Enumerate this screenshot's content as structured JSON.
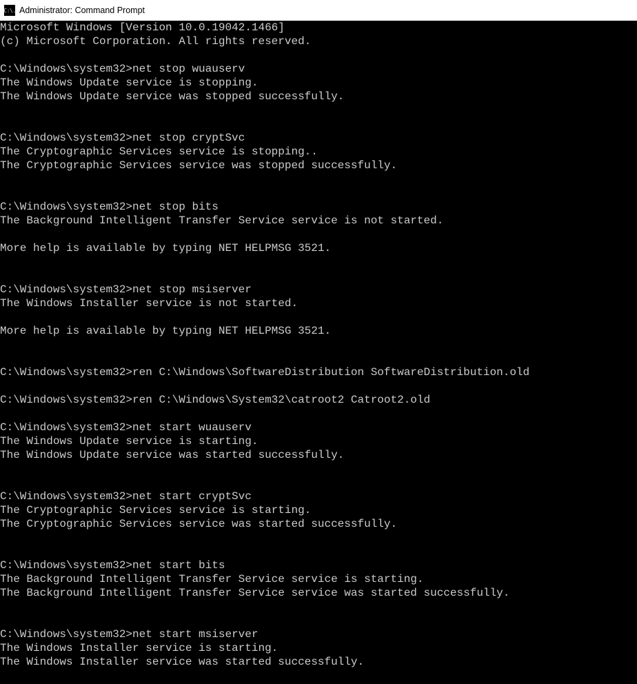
{
  "window": {
    "title": "Administrator: Command Prompt",
    "icon_label": "C:\\."
  },
  "terminal": {
    "lines": [
      "Microsoft Windows [Version 10.0.19042.1466]",
      "(c) Microsoft Corporation. All rights reserved.",
      "",
      "C:\\Windows\\system32>net stop wuauserv",
      "The Windows Update service is stopping.",
      "The Windows Update service was stopped successfully.",
      "",
      "",
      "C:\\Windows\\system32>net stop cryptSvc",
      "The Cryptographic Services service is stopping..",
      "The Cryptographic Services service was stopped successfully.",
      "",
      "",
      "C:\\Windows\\system32>net stop bits",
      "The Background Intelligent Transfer Service service is not started.",
      "",
      "More help is available by typing NET HELPMSG 3521.",
      "",
      "",
      "C:\\Windows\\system32>net stop msiserver",
      "The Windows Installer service is not started.",
      "",
      "More help is available by typing NET HELPMSG 3521.",
      "",
      "",
      "C:\\Windows\\system32>ren C:\\Windows\\SoftwareDistribution SoftwareDistribution.old",
      "",
      "C:\\Windows\\system32>ren C:\\Windows\\System32\\catroot2 Catroot2.old",
      "",
      "C:\\Windows\\system32>net start wuauserv",
      "The Windows Update service is starting.",
      "The Windows Update service was started successfully.",
      "",
      "",
      "C:\\Windows\\system32>net start cryptSvc",
      "The Cryptographic Services service is starting.",
      "The Cryptographic Services service was started successfully.",
      "",
      "",
      "C:\\Windows\\system32>net start bits",
      "The Background Intelligent Transfer Service service is starting.",
      "The Background Intelligent Transfer Service service was started successfully.",
      "",
      "",
      "C:\\Windows\\system32>net start msiserver",
      "The Windows Installer service is starting.",
      "The Windows Installer service was started successfully."
    ]
  }
}
